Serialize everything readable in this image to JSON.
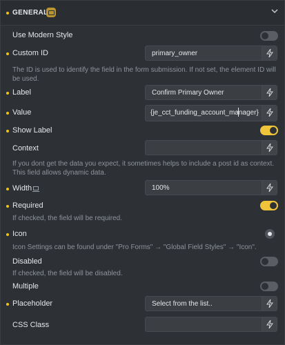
{
  "header": {
    "title": "GENERAL"
  },
  "fields": {
    "modern_style": {
      "label": "Use Modern Style",
      "enabled": false
    },
    "custom_id": {
      "label": "Custom ID",
      "value": "primary_owner",
      "description": "The ID is used to identify the field in the form submission. If not set, the element ID will be used."
    },
    "label_field": {
      "label": "Label",
      "value": "Confirm Primary Owner"
    },
    "value_field": {
      "label": "Value",
      "value": "{je_cct_funding_account_manager}"
    },
    "show_label": {
      "label": "Show Label",
      "enabled": true
    },
    "context": {
      "label": "Context",
      "value": "",
      "description": "If you dont get the data you expect, it sometimes helps to include a post id as context. This field allows dynamic data."
    },
    "width": {
      "label": "Width",
      "value": "100%"
    },
    "required": {
      "label": "Required",
      "enabled": true,
      "description": "If checked, the field will be required."
    },
    "icon": {
      "label": "Icon",
      "description": "Icon Settings can be found under \"Pro Forms\" → \"Global Field Styles\" → \"Icon\"."
    },
    "disabled": {
      "label": "Disabled",
      "enabled": false,
      "description": "If checked, the field will be disabled."
    },
    "multiple": {
      "label": "Multiple",
      "enabled": false
    },
    "placeholder": {
      "label": "Placeholder",
      "value": "Select from the list.."
    },
    "css_class": {
      "label": "CSS Class",
      "value": ""
    }
  },
  "colors": {
    "accent": "#f1c40f",
    "toggle_on": "#f0c43a",
    "background": "#2d3035",
    "input_bg": "#3b3f44",
    "muted_text": "#8f949a"
  },
  "icons": {
    "header_badge": "element-badge-icon",
    "collapse": "chevron-down-icon",
    "dynamic_data": "bolt-icon",
    "responsive": "laptop-icon",
    "icon_picker": "icon-picker-icon"
  }
}
